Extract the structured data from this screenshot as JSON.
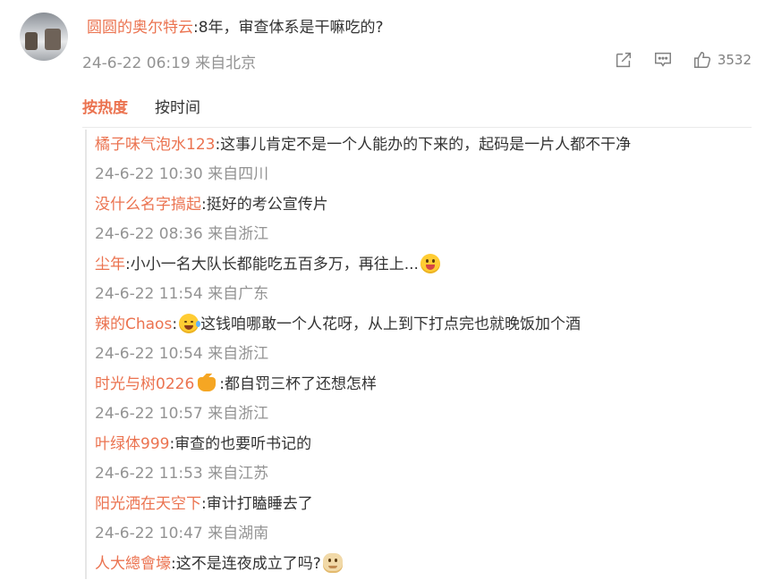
{
  "post": {
    "username": "圆圆的奥尔特云",
    "text": ":8年，审查体系是干嘛吃的?",
    "time": "24-6-22 06:19",
    "location": "来自北京",
    "like_count": "3532",
    "icons": [
      "share-icon",
      "comment-icon",
      "like-icon"
    ]
  },
  "tabs": [
    {
      "label": "按热度",
      "active": true
    },
    {
      "label": "按时间",
      "active": false
    }
  ],
  "colors": {
    "accent": "#eb7350",
    "meta": "#939393",
    "text": "#333333"
  },
  "replies": [
    {
      "user": "橘子味气泡水123",
      "text": ":这事儿肯定不是一个人能办的下来的，起码是一片人都不干净",
      "time": "24-6-22 10:30",
      "location": "来自四川"
    },
    {
      "user": "没什么名字搞起",
      "text": ":挺好的考公宣传片",
      "time": "24-6-22 08:36",
      "location": "来自浙江"
    },
    {
      "user": "尘年",
      "text": ":小小一名大队长都能吃五百多万，再往上...",
      "emoji_after": "tongue-emoji",
      "time": "24-6-22 11:54",
      "location": "来自广东"
    },
    {
      "user": "辣的Chaos",
      "text_before": ":",
      "emoji_mid": "laugh-cry-emoji",
      "text": "这钱咱哪敢一个人花呀，从上到下打点完也就晚饭加个酒",
      "time": "24-6-22 10:54",
      "location": "来自浙江"
    },
    {
      "user": "时光与树0226",
      "badge": "crown-badge",
      "text": ":都自罚三杯了还想怎样",
      "time": "24-6-22 10:57",
      "location": "来自浙江"
    },
    {
      "user": "叶绿体999",
      "text": ":审查的也要听书记的",
      "time": "24-6-22 11:53",
      "location": "来自江苏"
    },
    {
      "user": "阳光洒在天空下",
      "text": ":审计打瞌睡去了",
      "time": "24-6-22 10:47",
      "location": "来自湖南"
    },
    {
      "user": "人大總會壕",
      "text": ":这不是连夜成立了吗?",
      "emoji_after": "doge-emoji"
    }
  ]
}
